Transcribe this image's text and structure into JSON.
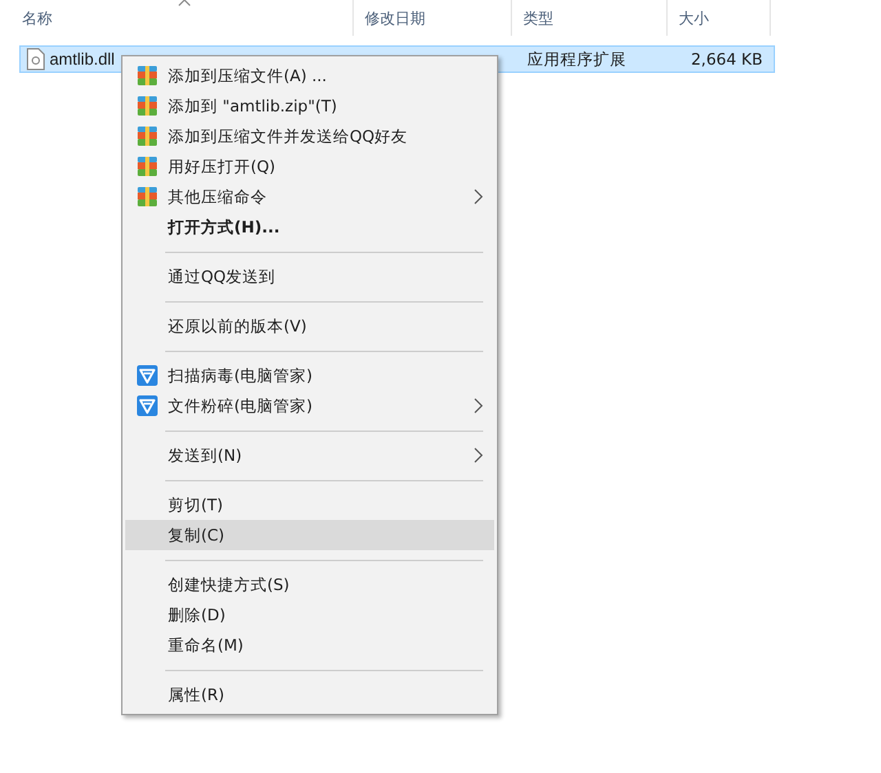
{
  "columns": [
    {
      "label": "名称",
      "sorted": true
    },
    {
      "label": "修改日期",
      "sorted": false
    },
    {
      "label": "类型",
      "sorted": false
    },
    {
      "label": "大小",
      "sorted": false
    }
  ],
  "file": {
    "name": "amtlib.dll",
    "type": "应用程序扩展",
    "size": "2,664 KB",
    "selected": true
  },
  "context_menu": [
    {
      "kind": "archive",
      "label": "添加到压缩文件(A) ...",
      "bold": false,
      "submenu": false,
      "selected": false
    },
    {
      "kind": "archive",
      "label": "添加到 \"amtlib.zip\"(T)",
      "bold": false,
      "submenu": false,
      "selected": false
    },
    {
      "kind": "archive",
      "label": "添加到压缩文件并发送给QQ好友",
      "bold": false,
      "submenu": false,
      "selected": false
    },
    {
      "kind": "archive",
      "label": "用好压打开(Q)",
      "bold": false,
      "submenu": false,
      "selected": false
    },
    {
      "kind": "archive",
      "label": "其他压缩命令",
      "bold": false,
      "submenu": true,
      "selected": false
    },
    {
      "kind": "plain",
      "label": "打开方式(H)...",
      "bold": true,
      "submenu": false,
      "selected": false
    },
    {
      "kind": "separator"
    },
    {
      "kind": "plain",
      "label": "通过QQ发送到",
      "bold": false,
      "submenu": false,
      "selected": false
    },
    {
      "kind": "separator"
    },
    {
      "kind": "plain",
      "label": "还原以前的版本(V)",
      "bold": false,
      "submenu": false,
      "selected": false
    },
    {
      "kind": "separator"
    },
    {
      "kind": "shield",
      "label": "扫描病毒(电脑管家)",
      "bold": false,
      "submenu": false,
      "selected": false
    },
    {
      "kind": "shield",
      "label": "文件粉碎(电脑管家)",
      "bold": false,
      "submenu": true,
      "selected": false
    },
    {
      "kind": "separator"
    },
    {
      "kind": "plain",
      "label": "发送到(N)",
      "bold": false,
      "submenu": true,
      "selected": false
    },
    {
      "kind": "separator"
    },
    {
      "kind": "plain",
      "label": "剪切(T)",
      "bold": false,
      "submenu": false,
      "selected": false
    },
    {
      "kind": "plain",
      "label": "复制(C)",
      "bold": false,
      "submenu": false,
      "selected": true
    },
    {
      "kind": "separator"
    },
    {
      "kind": "plain",
      "label": "创建快捷方式(S)",
      "bold": false,
      "submenu": false,
      "selected": false
    },
    {
      "kind": "plain",
      "label": "删除(D)",
      "bold": false,
      "submenu": false,
      "selected": false
    },
    {
      "kind": "plain",
      "label": "重命名(M)",
      "bold": false,
      "submenu": false,
      "selected": false
    },
    {
      "kind": "separator"
    },
    {
      "kind": "plain",
      "label": "属性(R)",
      "bold": false,
      "submenu": false,
      "selected": false
    }
  ]
}
